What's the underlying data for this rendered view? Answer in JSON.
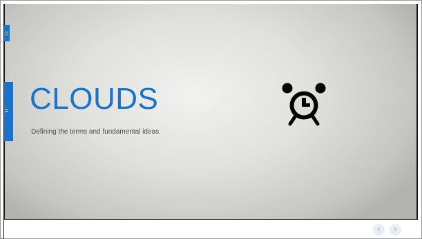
{
  "slide": {
    "title": "CLOUDS",
    "subtitle": "Defining the terms and fundamental ideas.",
    "title_color": "#1a73c8",
    "accent_color": "#1a73c8",
    "icon": "alarm-clock-icon"
  },
  "navigation": {
    "prev_icon": "‹",
    "next_icon": "›"
  }
}
